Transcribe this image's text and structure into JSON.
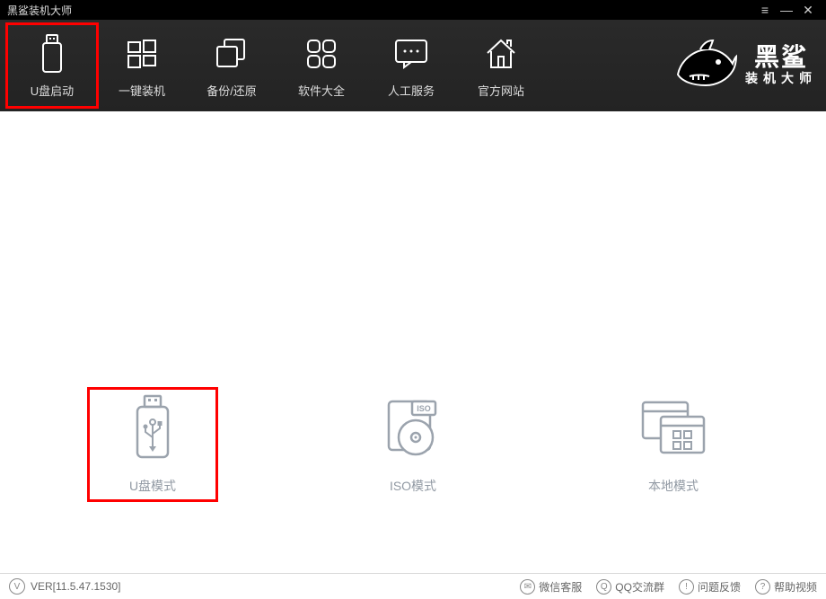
{
  "window": {
    "title": "黑鲨装机大师"
  },
  "nav": {
    "items": [
      {
        "label": "U盘启动",
        "icon": "usb"
      },
      {
        "label": "一键装机",
        "icon": "windows"
      },
      {
        "label": "备份/还原",
        "icon": "copy"
      },
      {
        "label": "软件大全",
        "icon": "grid"
      },
      {
        "label": "人工服务",
        "icon": "chat"
      },
      {
        "label": "官方网站",
        "icon": "home"
      }
    ]
  },
  "logo": {
    "line1": "黑鲨",
    "line2": "装机大师"
  },
  "modes": [
    {
      "label": "U盘模式",
      "icon": "usb-large"
    },
    {
      "label": "ISO模式",
      "icon": "iso"
    },
    {
      "label": "本地模式",
      "icon": "local"
    }
  ],
  "footer": {
    "version": "VER[11.5.47.1530]",
    "links": [
      {
        "label": "微信客服",
        "icon": "wechat"
      },
      {
        "label": "QQ交流群",
        "icon": "qq"
      },
      {
        "label": "问题反馈",
        "icon": "feedback"
      },
      {
        "label": "帮助视频",
        "icon": "help"
      }
    ]
  }
}
